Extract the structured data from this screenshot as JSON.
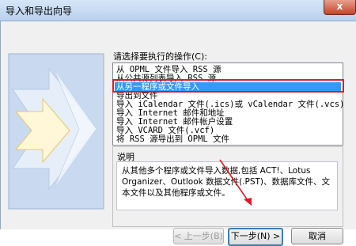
{
  "window": {
    "title": "导入和导出向导",
    "close_glyph": "x"
  },
  "prompt_label": "请选择要执行的操作(C):",
  "actions": [
    "从 OPML 文件导入 RSS 源",
    "从公共源列表导入 RSS 源",
    "从另一程序或文件导入",
    "导出到文件",
    "导入 iCalendar 文件(.ics)或 vCalendar 文件(.vcs)",
    "导入 Internet 邮件和地址",
    "导入 Internet 邮件帐户设置",
    "导入 VCARD 文件(.vcf)",
    "将 RSS 源导出到 OPML 文件"
  ],
  "selected_index": 2,
  "description": {
    "label": "说明",
    "text": "从其他多个程序或文件导入数据,包括 ACT!、Lotus Organizer、Outlook 数据文件(.PST)、数据库文件、文本文件以及其他程序或文件。"
  },
  "buttons": {
    "back": "< 上一步(B)",
    "next": "下一步(N) >",
    "cancel": "取消"
  },
  "colors": {
    "selection": "#3399ff",
    "highlight": "#e0192a",
    "arrow": "#e0192a"
  }
}
